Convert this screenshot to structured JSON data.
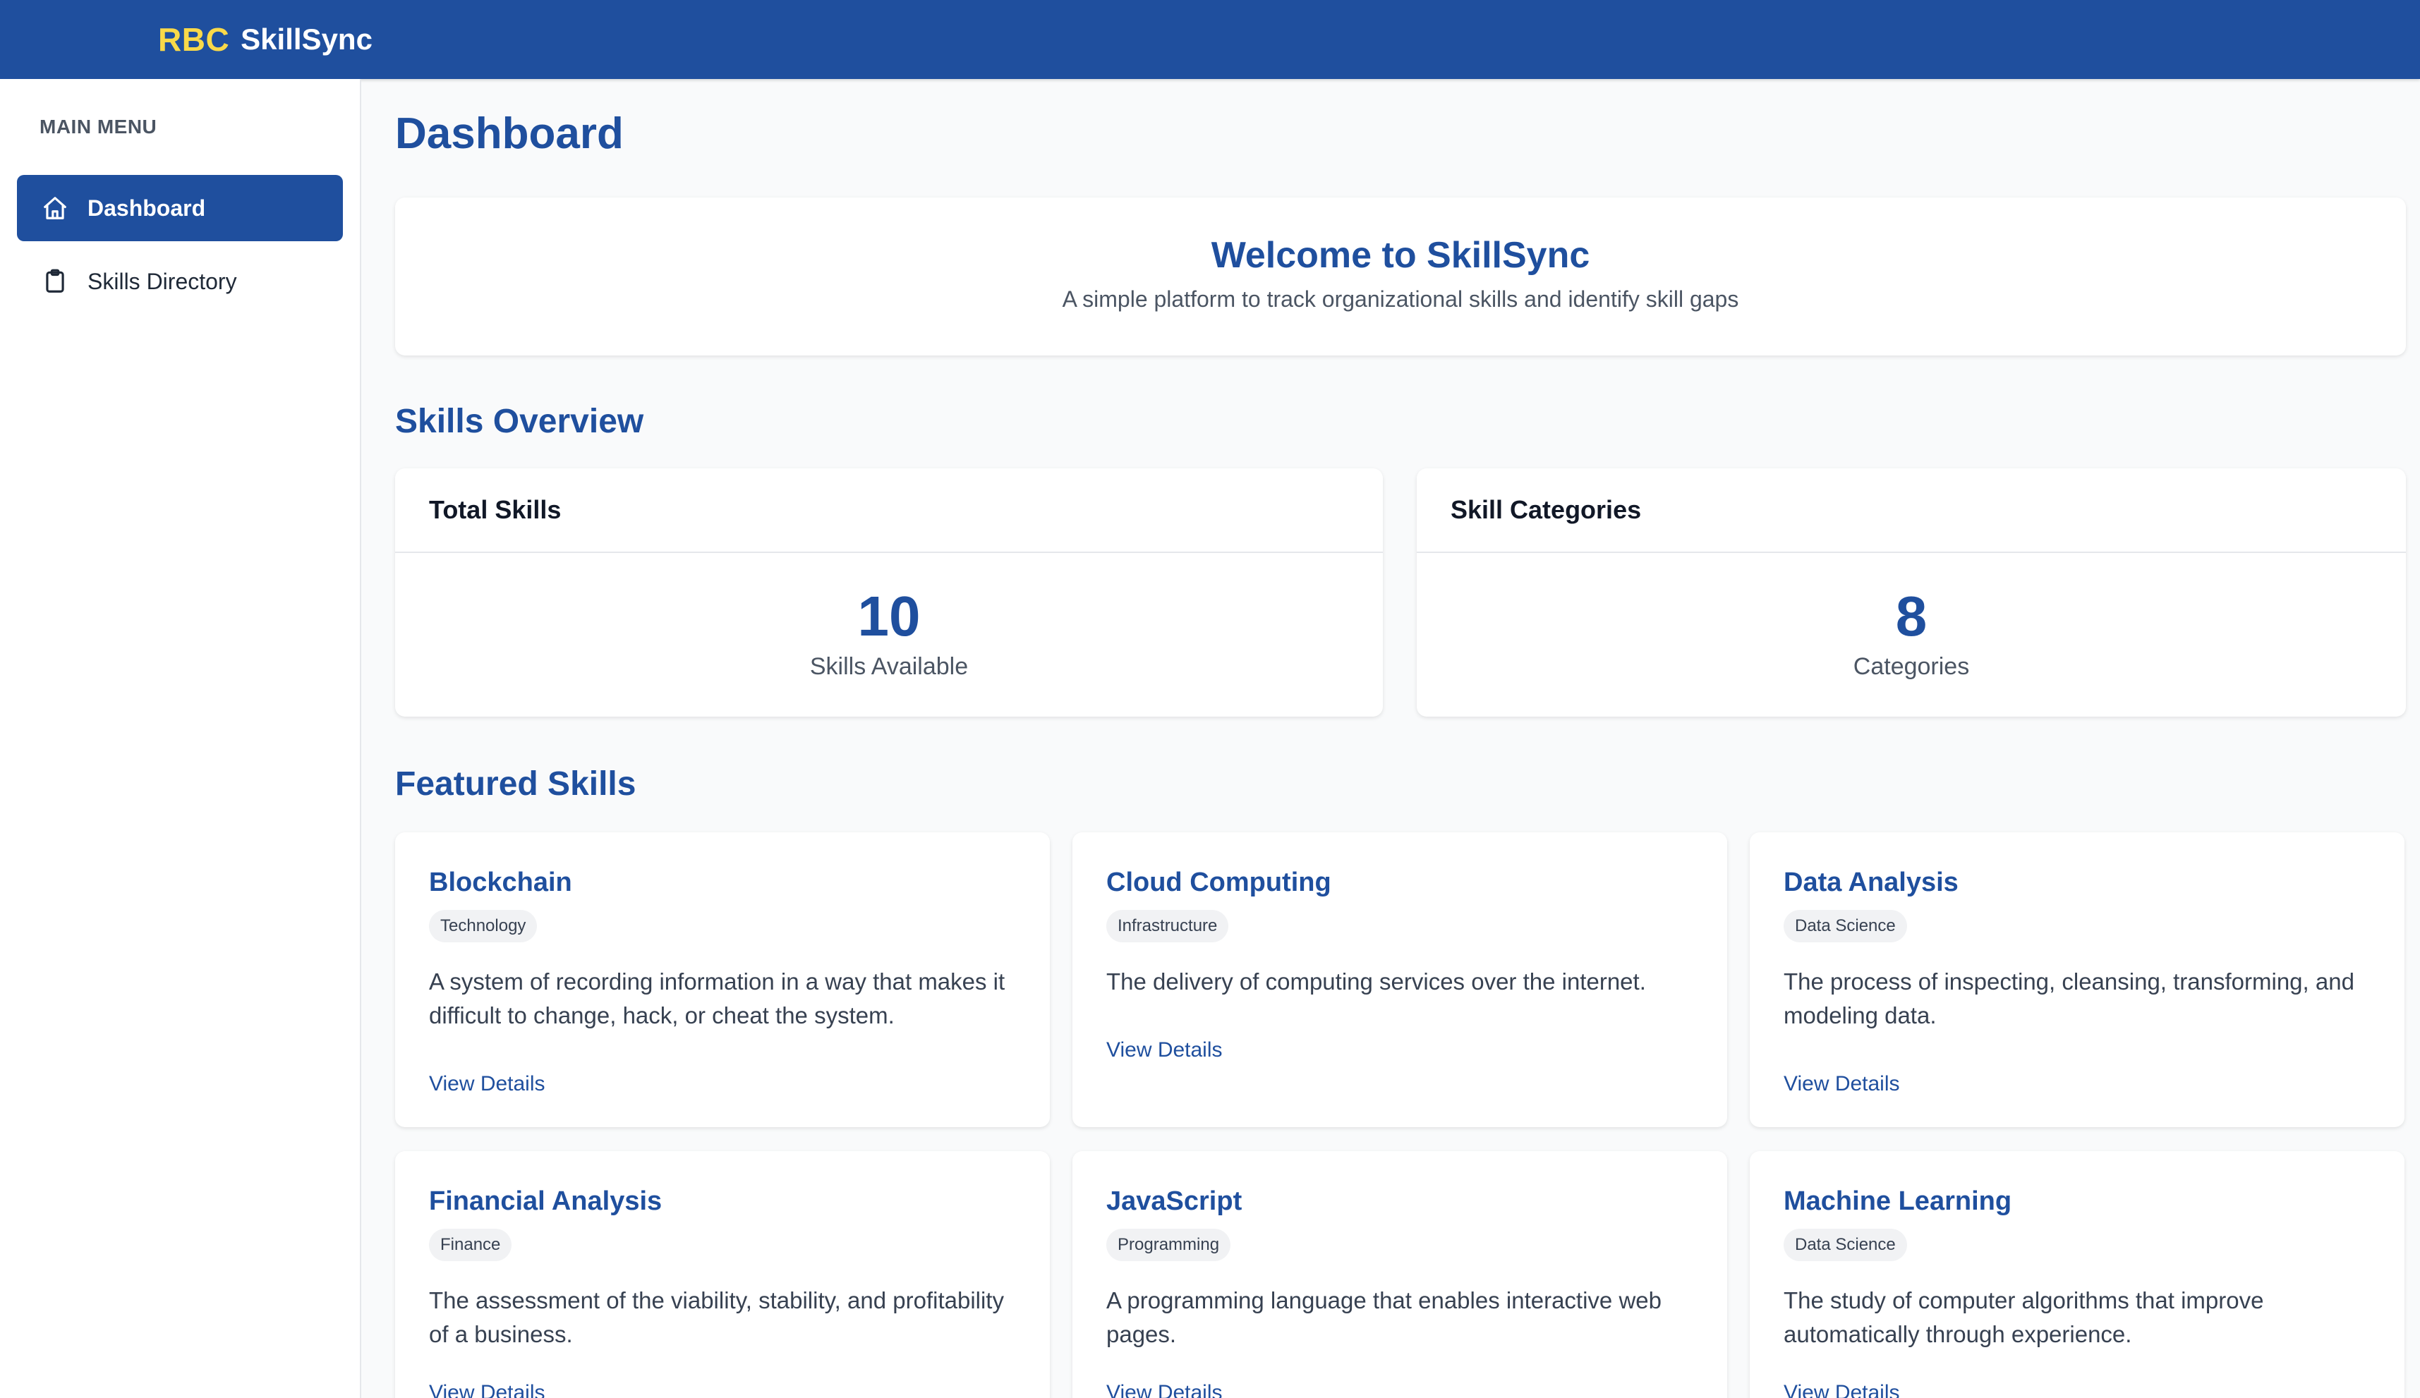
{
  "header": {
    "brand_prefix": "RBC",
    "brand_name": "SkillSync"
  },
  "sidebar": {
    "heading": "MAIN MENU",
    "items": [
      {
        "label": "Dashboard",
        "icon": "home-icon",
        "active": true
      },
      {
        "label": "Skills Directory",
        "icon": "clipboard-icon",
        "active": false
      }
    ]
  },
  "main": {
    "title": "Dashboard",
    "welcome": {
      "title": "Welcome to SkillSync",
      "subtitle": "A simple platform to track organizational skills and identify skill gaps"
    },
    "overview": {
      "title": "Skills Overview",
      "stats": [
        {
          "heading": "Total Skills",
          "value": "10",
          "label": "Skills Available"
        },
        {
          "heading": "Skill Categories",
          "value": "8",
          "label": "Categories"
        }
      ]
    },
    "featured": {
      "title": "Featured Skills",
      "link_label": "View Details",
      "skills": [
        {
          "name": "Blockchain",
          "category": "Technology",
          "description": "A system of recording information in a way that makes it difficult to change, hack, or cheat the system."
        },
        {
          "name": "Cloud Computing",
          "category": "Infrastructure",
          "description": "The delivery of computing services over the internet."
        },
        {
          "name": "Data Analysis",
          "category": "Data Science",
          "description": "The process of inspecting, cleansing, transforming, and modeling data."
        },
        {
          "name": "Financial Analysis",
          "category": "Finance",
          "description": "The assessment of the viability, stability, and profitability of a business."
        },
        {
          "name": "JavaScript",
          "category": "Programming",
          "description": "A programming language that enables interactive web pages."
        },
        {
          "name": "Machine Learning",
          "category": "Data Science",
          "description": "The study of computer algorithms that improve automatically through experience."
        }
      ]
    }
  },
  "colors": {
    "brand_blue": "#1f4f9e",
    "brand_yellow": "#f9d949",
    "background": "#f9fafb"
  }
}
